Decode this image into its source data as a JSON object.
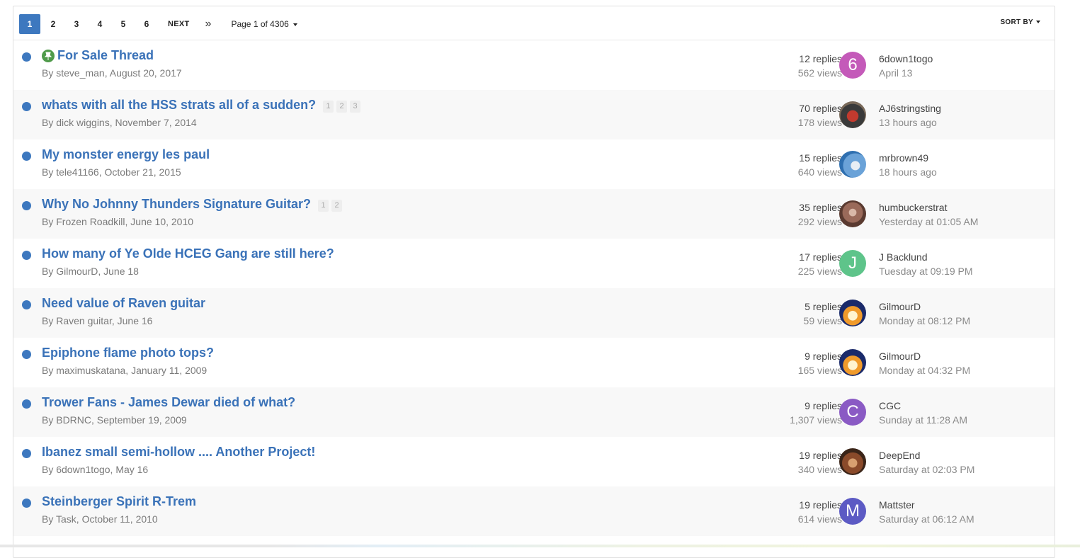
{
  "pagination": {
    "pages": [
      "1",
      "2",
      "3",
      "4",
      "5",
      "6"
    ],
    "active_page": "1",
    "next_label": "NEXT",
    "last_icon": "»",
    "page_info": "Page 1 of 4306",
    "sort_label": "SORT BY"
  },
  "colors": {
    "accent": "#3d78bf",
    "title_link": "#3a72b8",
    "pinned": "#4f9a4a"
  },
  "topics": [
    {
      "title": "For Sale Thread",
      "pinned": true,
      "mini_pages": [],
      "author": "steve_man",
      "date": "August 20, 2017",
      "replies": "12 replies",
      "views": "562 views",
      "last_poster": "6down1togo",
      "last_time": "April 13",
      "avatar": {
        "letter": "6",
        "color": "#c45ab9"
      }
    },
    {
      "title": "whats with all the HSS strats all of a sudden?",
      "pinned": false,
      "mini_pages": [
        "1",
        "2",
        "3"
      ],
      "author": "dick wiggins",
      "date": "November 7, 2014",
      "replies": "70 replies",
      "views": "178 views",
      "last_poster": "AJ6stringsting",
      "last_time": "13 hours ago",
      "avatar": {
        "letter": "",
        "photo": "person-red"
      }
    },
    {
      "title": "My monster energy les paul",
      "pinned": false,
      "mini_pages": [],
      "author": "tele41166",
      "date": "October 21, 2015",
      "replies": "15 replies",
      "views": "640 views",
      "last_poster": "mrbrown49",
      "last_time": "18 hours ago",
      "avatar": {
        "letter": "",
        "photo": "blue-sky"
      }
    },
    {
      "title": "Why No Johnny Thunders Signature Guitar?",
      "pinned": false,
      "mini_pages": [
        "1",
        "2"
      ],
      "author": "Frozen Roadkill",
      "date": "June 10, 2010",
      "replies": "35 replies",
      "views": "292 views",
      "last_poster": "humbuckerstrat",
      "last_time": "Yesterday at 01:05 AM",
      "avatar": {
        "letter": "",
        "photo": "brown-group"
      }
    },
    {
      "title": "How many of Ye Olde HCEG Gang are still here?",
      "pinned": false,
      "mini_pages": [],
      "author": "GilmourD",
      "date": "June 18",
      "replies": "17 replies",
      "views": "225 views",
      "last_poster": "J Backlund",
      "last_time": "Tuesday at 09:19 PM",
      "avatar": {
        "letter": "J",
        "color": "#5ec48a"
      }
    },
    {
      "title": "Need value of Raven guitar",
      "pinned": false,
      "mini_pages": [],
      "author": "Raven guitar",
      "date": "June 16",
      "replies": "5 replies",
      "views": "59 views",
      "last_poster": "GilmourD",
      "last_time": "Monday at 08:12 PM",
      "avatar": {
        "letter": "",
        "photo": "fire-cake"
      }
    },
    {
      "title": "Epiphone flame photo tops?",
      "pinned": false,
      "mini_pages": [],
      "author": "maximuskatana",
      "date": "January 11, 2009",
      "replies": "9 replies",
      "views": "165 views",
      "last_poster": "GilmourD",
      "last_time": "Monday at 04:32 PM",
      "avatar": {
        "letter": "",
        "photo": "fire-cake"
      }
    },
    {
      "title": "Trower Fans - James Dewar died of what?",
      "pinned": false,
      "mini_pages": [],
      "author": "BDRNC",
      "date": "September 19, 2009",
      "replies": "9 replies",
      "views": "1,307 views",
      "last_poster": "CGC",
      "last_time": "Sunday at 11:28 AM",
      "avatar": {
        "letter": "C",
        "color": "#8a5ac4"
      }
    },
    {
      "title": "Ibanez small semi-hollow .... Another Project!",
      "pinned": false,
      "mini_pages": [],
      "author": "6down1togo",
      "date": "May 16",
      "replies": "19 replies",
      "views": "340 views",
      "last_poster": "DeepEnd",
      "last_time": "Saturday at 02:03 PM",
      "avatar": {
        "letter": "",
        "photo": "guitar-brown"
      }
    },
    {
      "title": "Steinberger Spirit R-Trem",
      "pinned": false,
      "mini_pages": [],
      "author": "Task",
      "date": "October 11, 2010",
      "replies": "19 replies",
      "views": "614 views",
      "last_poster": "Mattster",
      "last_time": "Saturday at 06:12 AM",
      "avatar": {
        "letter": "M",
        "color": "#5c5ac4"
      }
    }
  ]
}
